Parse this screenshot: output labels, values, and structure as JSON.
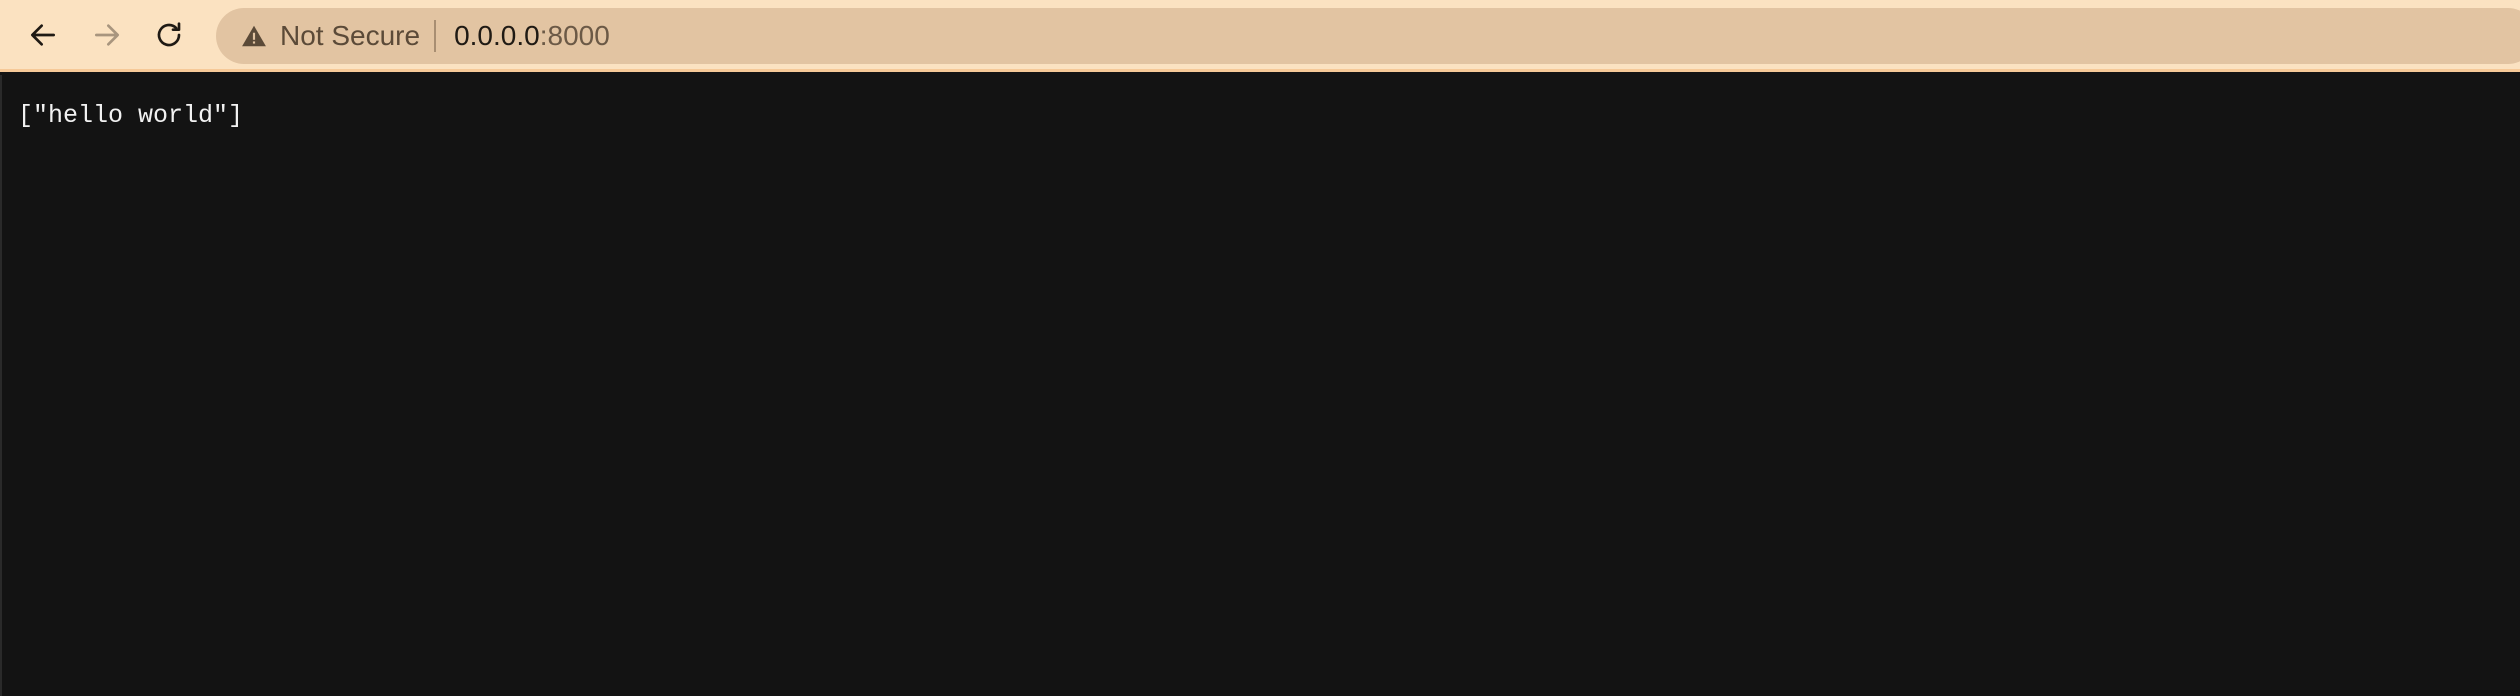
{
  "browser": {
    "nav": {
      "back_icon": "arrow-left-icon",
      "forward_icon": "arrow-right-icon",
      "forward_enabled": false,
      "reload_icon": "reload-icon"
    },
    "omnibox": {
      "security_icon": "warning-triangle-icon",
      "security_label": "Not Secure",
      "url_host": "0.0.0.0",
      "url_port": ":8000"
    },
    "colors": {
      "toolbar_bg": "#fbe2c1",
      "omnibox_bg": "#e2c4a2",
      "page_bg": "#131313",
      "text": "#f2f2f2"
    }
  },
  "page": {
    "body_text": "[\"hello world\"]"
  }
}
